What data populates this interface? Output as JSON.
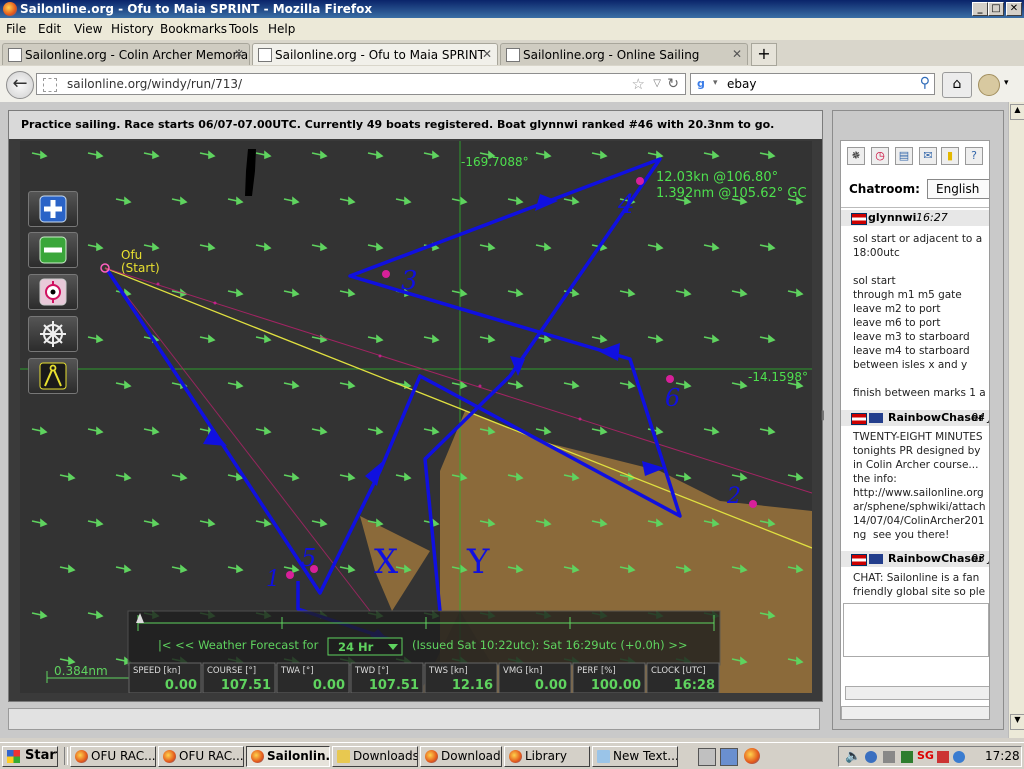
{
  "window": {
    "title": "Sailonline.org - Ofu to Maia SPRINT - Mozilla Firefox"
  },
  "menu": [
    "File",
    "Edit",
    "View",
    "History",
    "Bookmarks",
    "Tools",
    "Help"
  ],
  "tabs": [
    {
      "label": "Sailonline.org - Colin Archer Memorial Rac..."
    },
    {
      "label": "Sailonline.org - Ofu to Maia SPRINT"
    },
    {
      "label": "Sailonline.org - Online Sailing"
    }
  ],
  "nav": {
    "url": "sailonline.org/windy/run/713/",
    "search": "ebay"
  },
  "info": {
    "text": "Practice sailing. Race starts 06/07-07.00UTC. Currently 49 boats registered. Boat glynnwi ranked #46 with 20.3nm to go."
  },
  "map": {
    "lon_label": "-169.7088°",
    "lat_label": "-14.1598°",
    "wind_line": "12.03kn @106.80°",
    "dist_line": "1.392nm @105.62° GC",
    "start_label_1": "Ofu",
    "start_label_2": "(Start)",
    "scale": "0.384nm",
    "forecast_prefix": "|< << Weather Forecast for",
    "forecast_range": "24 Hr",
    "forecast_issued": "(Issued Sat 10:22utc): Sat 16:29utc  (+0.0h)  >>",
    "marks": [
      "1",
      "2",
      "3",
      "4",
      "5",
      "6",
      "X",
      "Y"
    ]
  },
  "instruments": [
    {
      "label": "SPEED [kn]",
      "value": "0.00"
    },
    {
      "label": "COURSE [°]",
      "value": "107.51"
    },
    {
      "label": "TWA [°]",
      "value": "0.00"
    },
    {
      "label": "TWD [°]",
      "value": "107.51"
    },
    {
      "label": "TWS [kn]",
      "value": "12.16"
    },
    {
      "label": "VMG [kn]",
      "value": "0.00"
    },
    {
      "label": "PERF [%]",
      "value": "100.00"
    },
    {
      "label": "CLOCK [UTC]",
      "value": "16:28"
    }
  ],
  "chat": {
    "label": "Chatroom:",
    "language": "English",
    "messages": [
      {
        "user": "glynnwi",
        "time": "16:27",
        "text": "sol start or adjacent to a\n18:00utc\n\nsol start\nthrough m1 m5 gate\nleave m2 to port\nleave m6 to port\nleave m3 to starboard\nleave m4 to starboard\nbetween isles x and y\n\nfinish between marks 1 a"
      },
      {
        "user": "RainbowChaser",
        "time": "04 J",
        "text": "TWENTY-EIGHT MINUTES\ntonights PR designed by\nin Colin Archer course...\nthe info:\nhttp://www.sailonline.org\nar/sphene/sphwiki/attach\n14/07/04/ColinArcher201\nng  see you there!"
      },
      {
        "user": "RainbowChaser",
        "time": "03 J",
        "text": "CHAT: Sailonline is a fan\nfriendly global site so ple"
      }
    ]
  },
  "taskbar": {
    "start": "Start",
    "items": [
      "OFU RAC...",
      "OFU RAC...",
      "Sailonlin...",
      "Downloads",
      "Downloads",
      "Library",
      "New Text..."
    ],
    "clock": "17:28"
  },
  "colors": {
    "route": "#1010e0",
    "wind_arrows": "#5fd35f",
    "land": "#8b6a3a",
    "sea": "#333333"
  }
}
